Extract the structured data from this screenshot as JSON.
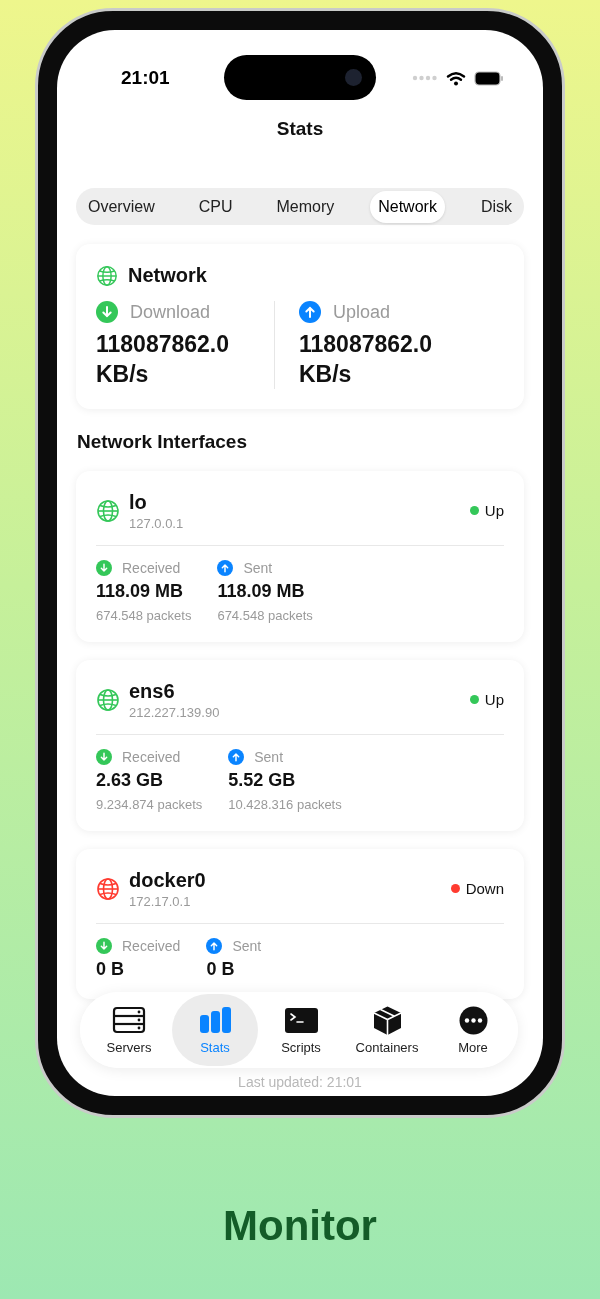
{
  "status_bar": {
    "time": "21:01"
  },
  "title": "Stats",
  "tabs": [
    {
      "label": "Overview",
      "selected": false
    },
    {
      "label": "CPU",
      "selected": false
    },
    {
      "label": "Memory",
      "selected": false
    },
    {
      "label": "Network",
      "selected": true
    },
    {
      "label": "Disk",
      "selected": false
    }
  ],
  "summary": {
    "title": "Network",
    "metrics": [
      {
        "kind": "download",
        "label": "Download",
        "value": "118087862.0 KB/s"
      },
      {
        "kind": "upload",
        "label": "Upload",
        "value": "118087862.0 KB/s"
      }
    ]
  },
  "section_title": "Network Interfaces",
  "interfaces": [
    {
      "name": "lo",
      "address": "127.0.0.1",
      "up": true,
      "status": "Up",
      "stats": [
        {
          "kind": "download",
          "label": "Received",
          "value": "118.09 MB",
          "packets": "674.548 packets"
        },
        {
          "kind": "upload",
          "label": "Sent",
          "value": "118.09 MB",
          "packets": "674.548 packets"
        }
      ]
    },
    {
      "name": "ens6",
      "address": "212.227.139.90",
      "up": true,
      "status": "Up",
      "stats": [
        {
          "kind": "download",
          "label": "Received",
          "value": "2.63 GB",
          "packets": "9.234.874 packets"
        },
        {
          "kind": "upload",
          "label": "Sent",
          "value": "5.52 GB",
          "packets": "10.428.316 packets"
        }
      ]
    },
    {
      "name": "docker0",
      "address": "172.17.0.1",
      "up": false,
      "status": "Down",
      "stats": [
        {
          "kind": "download",
          "label": "Received",
          "value": "0 B"
        },
        {
          "kind": "upload",
          "label": "Sent",
          "value": "0 B"
        }
      ]
    }
  ],
  "tab_bar": [
    {
      "kind": "servers",
      "label": "Servers",
      "selected": false
    },
    {
      "kind": "stats",
      "label": "Stats",
      "selected": true
    },
    {
      "kind": "scripts",
      "label": "Scripts",
      "selected": false
    },
    {
      "kind": "containers",
      "label": "Containers",
      "selected": false
    },
    {
      "kind": "more",
      "label": "More",
      "selected": false
    }
  ],
  "footer": "Last updated: 21:01",
  "caption": "Monitor"
}
